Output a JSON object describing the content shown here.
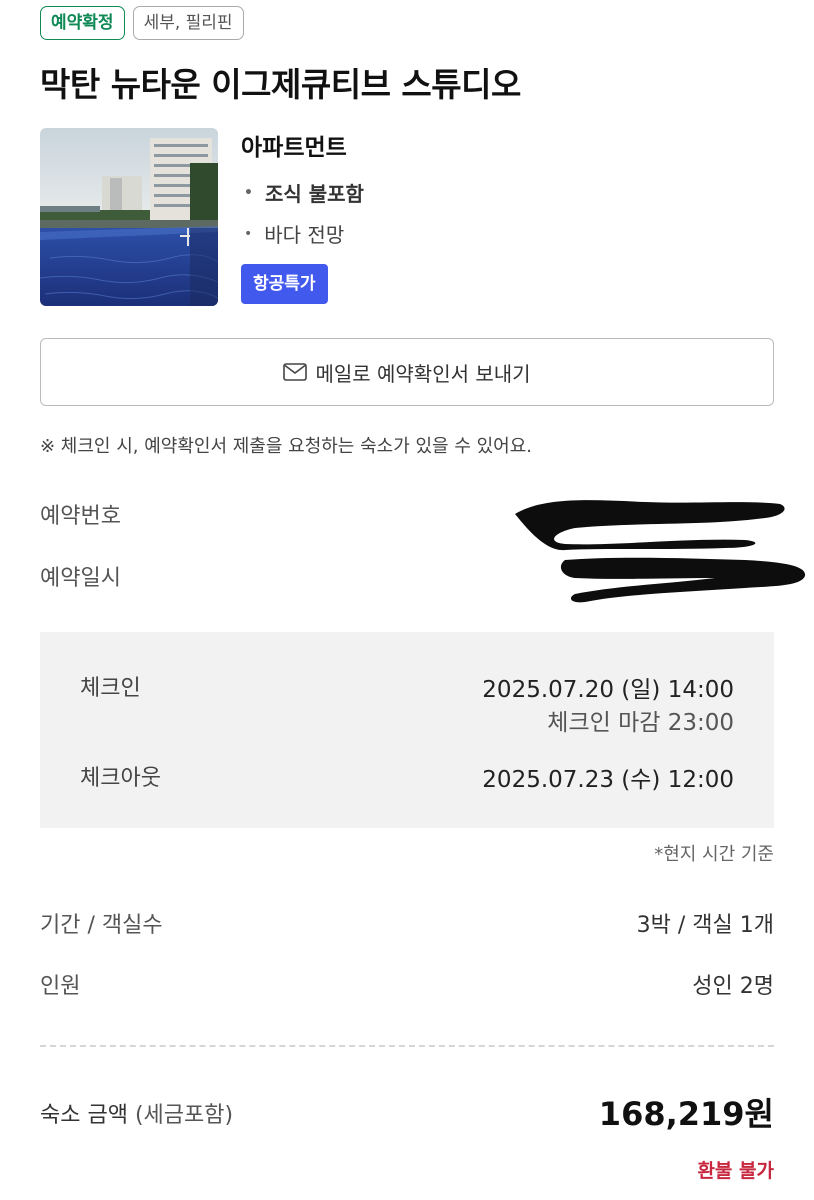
{
  "badges": {
    "confirmed": "예약확정",
    "location": "세부, 필리핀"
  },
  "hotel": {
    "name": "막탄 뉴타운 이그제큐티브 스튜디오",
    "image_icon": "hotel-pool-photo"
  },
  "room": {
    "name": "아파트먼트",
    "features": [
      "조식 불포함",
      "바다 전망"
    ],
    "promo_badge": "항공특가"
  },
  "email_button": {
    "icon": "mail-icon",
    "label": "메일로 예약확인서 보내기"
  },
  "notice": "※ 체크인 시, 예약확인서 제출을 요청하는 숙소가 있을 수 있어요.",
  "reservation": {
    "number_label": "예약번호",
    "date_label": "예약일시"
  },
  "schedule": {
    "checkin_label": "체크인",
    "checkin_value": "2025.07.20 (일) 14:00",
    "checkin_deadline": "체크인 마감 23:00",
    "checkout_label": "체크아웃",
    "checkout_value": "2025.07.23 (수) 12:00",
    "local_time_note": "*현지 시간 기준"
  },
  "stay": {
    "period_label": "기간 / 객실수",
    "period_value": "3박 / 객실 1개",
    "guests_label": "인원",
    "guests_value": "성인 2명"
  },
  "price": {
    "label": "숙소 금액",
    "label_note": "(세금포함)",
    "amount": "168,219원",
    "refund_policy": "환불 불가"
  },
  "colors": {
    "confirmed_green": "#0f8a55",
    "promo_blue": "#4259ee",
    "refund_red": "#c8283f",
    "panel_gray": "#f2f2f2"
  }
}
